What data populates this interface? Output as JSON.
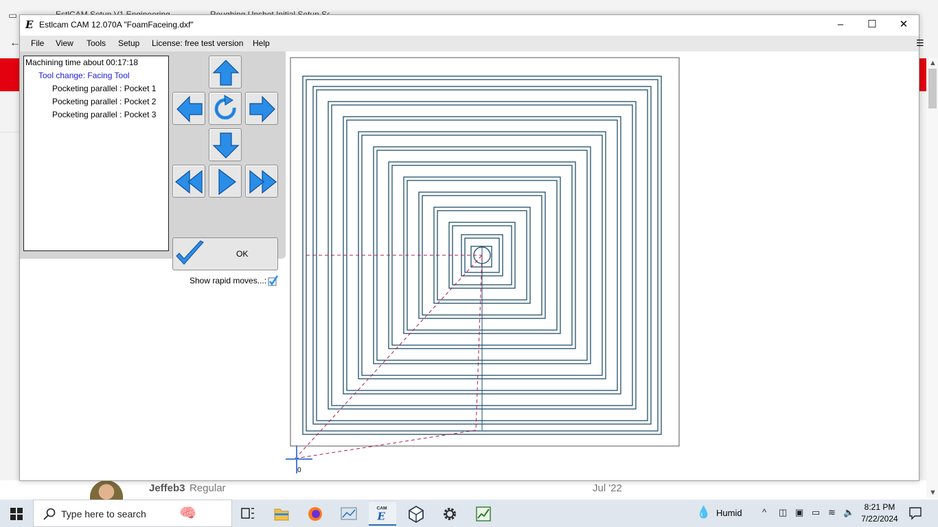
{
  "window": {
    "title": "Estlcam CAM 12.070A \"FoamFaceing.dxf\"",
    "logo": "E",
    "minimize": "–",
    "maximize": "☐",
    "close": "✕"
  },
  "menu": [
    "File",
    "View",
    "Tools",
    "Setup",
    "License: free test version",
    "Help"
  ],
  "job_list": [
    "Machining time about 00:17:18",
    "Tool change: Facing Tool",
    "Pocketing parallel : Pocket 1",
    "Pocketing parallel : Pocket 2",
    "Pocketing parallel : Pocket 3"
  ],
  "controls": {
    "ok_label": "OK",
    "show_rapid_label": "Show rapid moves...:",
    "show_rapid_checked": true,
    "accent": "#2a8de8"
  },
  "canvas": {
    "origin_label": "0",
    "toolpath_color": "#1f4e6a",
    "rapid_color": "#b0185a"
  },
  "background_page": {
    "tabs": [
      "EstlCAM Setup V1 Engineering",
      "Roughing Upshot Initial Setup Set"
    ],
    "forum_user": "Jeffeb3",
    "forum_role": "Regular",
    "forum_date": "Jul '22"
  },
  "taskbar": {
    "search_placeholder": "Type here to search",
    "apps": [
      "task-view",
      "file-explorer",
      "firefox",
      "photos",
      "estlcam",
      "3d-app",
      "settings",
      "activity-monitor"
    ],
    "weather": "Humid",
    "time": "8:21 PM",
    "date": "7/22/2024"
  }
}
